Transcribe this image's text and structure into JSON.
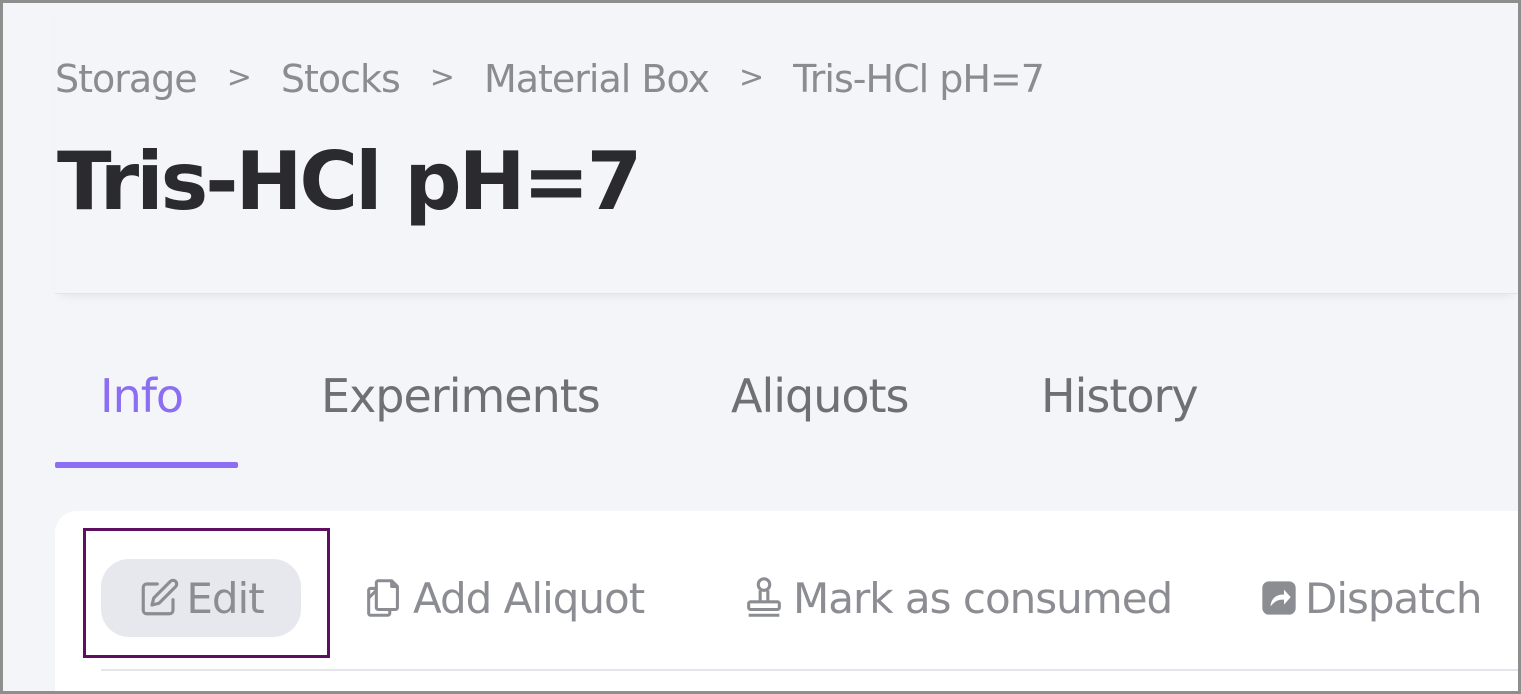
{
  "breadcrumb": {
    "items": [
      "Storage",
      "Stocks",
      "Material Box"
    ],
    "current": "Tris-HCl pH=7",
    "separator": ">"
  },
  "page": {
    "title": "Tris-HCl pH=7"
  },
  "tabs": [
    {
      "label": "Info",
      "active": true
    },
    {
      "label": "Experiments",
      "active": false
    },
    {
      "label": "Aliquots",
      "active": false
    },
    {
      "label": "History",
      "active": false
    }
  ],
  "toolbar": {
    "edit_label": "Edit",
    "add_aliquot_label": "Add Aliquot",
    "mark_consumed_label": "Mark as consumed",
    "dispatch_label": "Dispatch"
  },
  "colors": {
    "accent": "#8b6ef2",
    "highlight_box": "#5e0f5f",
    "text_muted": "#8c8d93",
    "title": "#2b2a2e"
  }
}
